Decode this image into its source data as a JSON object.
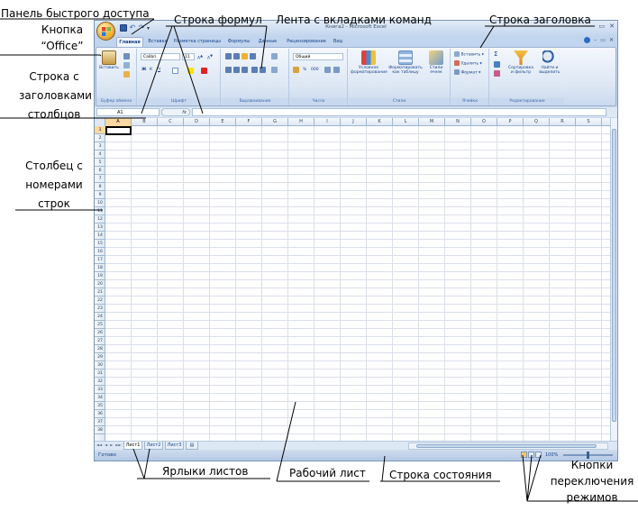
{
  "annotations": {
    "qat": "Панель быстрого доступа",
    "office_button": [
      "Кнопка",
      "“Office”"
    ],
    "formula_bar": "Строка формул",
    "ribbon": "Лента с вкладками команд",
    "title_bar": "Строка заголовка",
    "column_headers": [
      "Строка с",
      "заголовками",
      "столбцов"
    ],
    "row_numbers": [
      "Столбец с",
      "номерами",
      "строк"
    ],
    "sheet_tabs": "Ярлыки листов",
    "worksheet": "Рабочий лист",
    "status_bar": "Строка состояния",
    "view_buttons": [
      "Кнопки",
      "переключения",
      "режимов"
    ]
  },
  "window": {
    "title": "Книга2 - Microsoft Excel",
    "controls": [
      "–",
      "▭",
      "✕"
    ],
    "ribbon_controls": [
      "–",
      "▭",
      "✕"
    ]
  },
  "qat_icons": [
    "save-icon",
    "undo-icon",
    "redo-icon"
  ],
  "tabs": [
    {
      "label": "Главная",
      "active": true
    },
    {
      "label": "Вставка",
      "active": false
    },
    {
      "label": "Разметка страницы",
      "active": false
    },
    {
      "label": "Формулы",
      "active": false
    },
    {
      "label": "Данные",
      "active": false
    },
    {
      "label": "Рецензирование",
      "active": false
    },
    {
      "label": "Вид",
      "active": false
    }
  ],
  "ribbon": {
    "clipboard": {
      "label": "Буфер обмена",
      "paste": "Вставить"
    },
    "font": {
      "label": "Шрифт",
      "font_name": "Calibri",
      "font_size": "11",
      "bold": "Ж",
      "italic": "К",
      "underline": "Ч"
    },
    "alignment": {
      "label": "Выравнивание"
    },
    "number": {
      "label": "Число",
      "format": "Общий",
      "percent": "%",
      "thousands": "000"
    },
    "styles": {
      "label": "Стили",
      "conditional": [
        "Условное",
        "форматирование"
      ],
      "as_table": [
        "Форматировать",
        "как таблицу"
      ],
      "cell_styles": [
        "Стили",
        "ячеек"
      ]
    },
    "cells": {
      "label": "Ячейки",
      "insert": "Вставить",
      "delete": "Удалить",
      "format": "Формат"
    },
    "editing": {
      "label": "Редактирование",
      "sort": [
        "Сортировка",
        "и фильтр"
      ],
      "find": [
        "Найти и",
        "выделить"
      ],
      "sum": "Σ"
    }
  },
  "formula_bar": {
    "name_box": "A1",
    "fx": "fx",
    "value": ""
  },
  "grid": {
    "columns": [
      "A",
      "B",
      "C",
      "D",
      "E",
      "F",
      "G",
      "H",
      "I",
      "J",
      "K",
      "L",
      "M",
      "N",
      "O",
      "P",
      "Q",
      "R",
      "S"
    ],
    "rows": [
      "1",
      "2",
      "3",
      "4",
      "5",
      "6",
      "7",
      "8",
      "9",
      "10",
      "11",
      "12",
      "13",
      "14",
      "15",
      "16",
      "17",
      "18",
      "19",
      "20",
      "21",
      "22",
      "23",
      "24",
      "25",
      "26",
      "27",
      "28",
      "29",
      "30",
      "31",
      "32",
      "33",
      "34",
      "35",
      "36",
      "37",
      "38"
    ],
    "active_cell": "A1"
  },
  "sheets": [
    {
      "label": "Лист1",
      "active": true
    },
    {
      "label": "Лист2",
      "active": false
    },
    {
      "label": "Лист3",
      "active": false
    }
  ],
  "sheet_nav": [
    "◄◄",
    "◄",
    "►",
    "►►"
  ],
  "status": {
    "text": "Готово",
    "zoom": "100%"
  },
  "colors": {
    "ribbon_bg": "#dbe6f4",
    "tab_text": "#15428b",
    "active_header": "#f9d99f",
    "office_button": "#f6c55e"
  }
}
